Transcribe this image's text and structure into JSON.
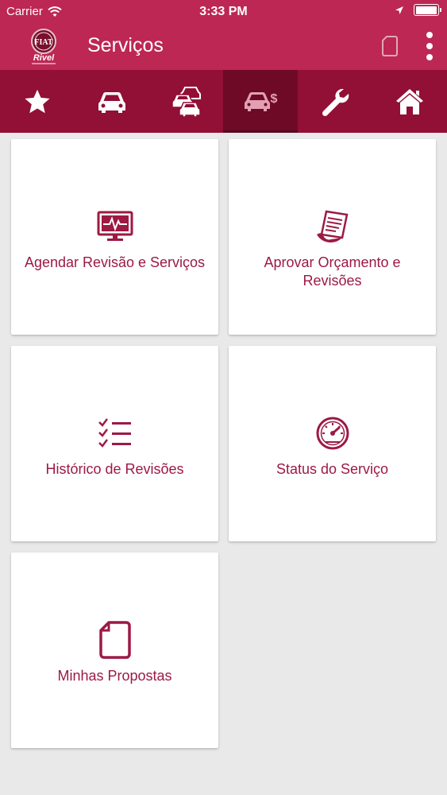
{
  "status": {
    "carrier": "Carrier",
    "time": "3:33 PM"
  },
  "header": {
    "title": "Serviços",
    "logo": {
      "brand": "FIAT",
      "dealer": "Rivel"
    }
  },
  "tabs": [
    {
      "icon": "star-icon",
      "active": false
    },
    {
      "icon": "car-icon",
      "active": false
    },
    {
      "icon": "cars-stack-icon",
      "active": false
    },
    {
      "icon": "car-money-icon",
      "active": true
    },
    {
      "icon": "wrench-icon",
      "active": false
    },
    {
      "icon": "home-icon",
      "active": false
    }
  ],
  "cards": [
    {
      "label": "Agendar Revisão e Serviços",
      "icon": "monitor-heartbeat-icon"
    },
    {
      "label": "Aprovar Orçamento e Revisões",
      "icon": "document-scroll-icon"
    },
    {
      "label": "Histórico de Revisões",
      "icon": "checklist-icon"
    },
    {
      "label": "Status do Serviço",
      "icon": "speedometer-icon"
    },
    {
      "label": "Minhas Propostas",
      "icon": "document-icon"
    }
  ],
  "colors": {
    "header": "#bd2753",
    "tabbar": "#920f35",
    "tab_active": "#6e0a25",
    "accent": "#9c1a44",
    "background": "#e9e9ea"
  }
}
